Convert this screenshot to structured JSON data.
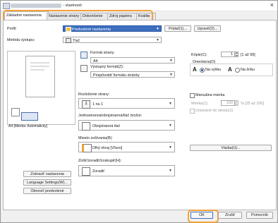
{
  "window": {
    "title": "- vlastnosti"
  },
  "tabs": [
    {
      "label": "Základné nastavenia"
    },
    {
      "label": "Nastavenie strany"
    },
    {
      "label": "Dokončenie"
    },
    {
      "label": "Zdroj papiera"
    },
    {
      "label": "Kvalita"
    }
  ],
  "top": {
    "profile_label": "Profil:",
    "profile_value": "Predvolené nastavenia",
    "add_button": "Pridať(1)...",
    "edit_button": "Upraviť(2)...",
    "output_label": "Metóda výstupu:",
    "output_value": "Tlač"
  },
  "preview": {
    "caption": "A4 [Mierka: Automaticky]",
    "restore_button": "Zobraziť nastavenia",
    "language_button": "Language Settings(W)...",
    "defaults_button": "Obnoviť predvolené"
  },
  "paper": {
    "page_size_label": "Formát strany:",
    "page_size_value": "A4",
    "output_size_label": "Výstupný formát(Z):",
    "output_size_value": "Prispôsobiť formátu stránky"
  },
  "copies": {
    "label": "Kópie(C):",
    "value": "1",
    "range": "[1 až 99]"
  },
  "orientation": {
    "label": "Orientácia(O)",
    "portrait": "Na výšku",
    "landscape": "Na šírku",
    "portrait_selected": true,
    "portrait_letter": "A",
    "landscape_letter": "A"
  },
  "layout": {
    "label": "Rozloženie strany:",
    "value": "1 na 1",
    "icon_text": "1"
  },
  "scaling": {
    "manual_label": "Manuálna mierka",
    "scale_label": "Mierka(1):",
    "scale_value": "100",
    "scale_range": "% [25 až 200]",
    "center_label": "Umiestniť do stredu(1)"
  },
  "duplex": {
    "label": "Jednostranná/obojstranná/tlač brožúr:",
    "value": "Obojstranná tlač"
  },
  "binding": {
    "label": "Miesto zošívania(B):",
    "value": "Dlhý okraj [Vľavo]",
    "margin_button": "Väzba(U)..."
  },
  "collate": {
    "label": "Zošiť/zoradiť/zoskupiť(H):",
    "value": "Zoradiť"
  },
  "footer": {
    "ok": "OK",
    "cancel": "Zrušiť",
    "help": "Pomocník"
  },
  "colors": {
    "highlight": "#f2a23a",
    "profile_bg": "#3c6fc0"
  }
}
